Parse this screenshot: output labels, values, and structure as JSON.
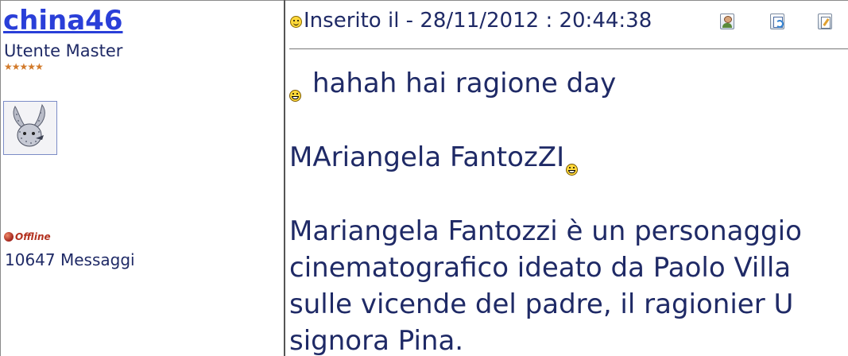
{
  "author": {
    "name": "china46",
    "rank": "Utente Master",
    "rank_stars": "★★★★★",
    "status": "Offline",
    "message_count": "10647 Messaggi"
  },
  "post": {
    "header_text": "Inserito il - 28/11/2012 : 20:44:38",
    "icons": [
      "profile-icon",
      "quote-icon",
      "edit-icon"
    ],
    "body": {
      "line1": "hahah hai ragione day",
      "line2": "MAriangela FantozZI",
      "paragraph": [
        "Mariangela Fantozzi è un personaggio",
        "cinematografico ideato da Paolo Villa",
        "sulle vicende del padre, il ragionier U",
        "signora Pina."
      ]
    }
  },
  "colors": {
    "link": "#2a3fd8",
    "text": "#1f2a66",
    "status": "#b3311f"
  }
}
